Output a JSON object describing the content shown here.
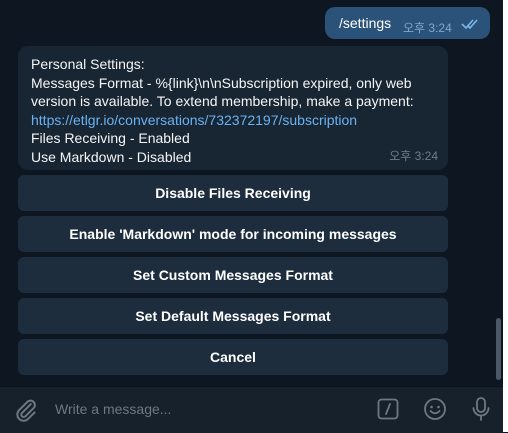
{
  "outgoing": {
    "text": "/settings",
    "time": "오후 3:24"
  },
  "incoming": {
    "lines": [
      "Personal Settings:",
      "Messages Format - %{link}\\n\\nSubscription expired, only web",
      "version is available. To extend membership, make a payment:",
      "https://etlgr.io/conversations/732372197/subscription",
      "Files Receiving - Enabled",
      "Use Markdown - Disabled"
    ],
    "time": "오후 3:24"
  },
  "keyboard": [
    "Disable Files Receiving",
    "Enable 'Markdown' mode for incoming messages",
    "Set Custom Messages Format",
    "Set Default Messages Format",
    "Cancel"
  ],
  "composer": {
    "placeholder": "Write a message..."
  },
  "icons": {
    "attach": "paperclip-icon",
    "commands": "slash-command-icon",
    "emoji": "smile-icon",
    "voice": "microphone-icon",
    "read": "double-check-icon"
  },
  "colors": {
    "background": "#0e1621",
    "outgoing_bubble": "#2b5278",
    "incoming_bubble": "#182533",
    "keyboard_button": "#1d2d3d",
    "link": "#6ab2f2",
    "input_bar": "#17212b"
  }
}
